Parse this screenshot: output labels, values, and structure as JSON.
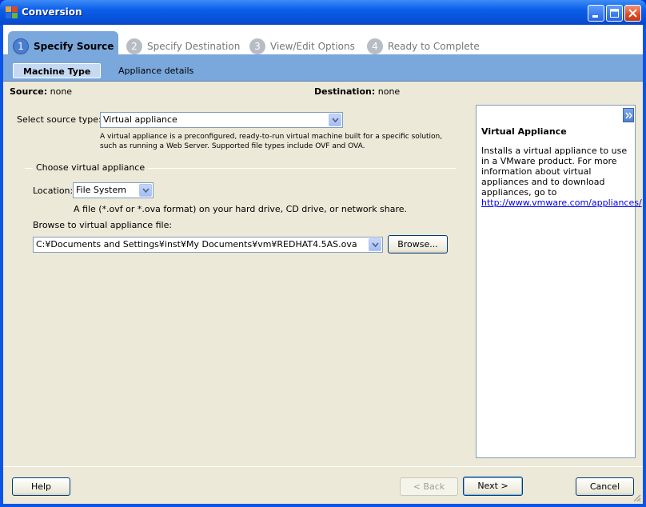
{
  "window": {
    "title": "Conversion",
    "accent": "#0a55e6"
  },
  "steps": [
    {
      "num": "1",
      "label": "Specify Source",
      "active": true
    },
    {
      "num": "2",
      "label": "Specify Destination"
    },
    {
      "num": "3",
      "label": "View/Edit Options"
    },
    {
      "num": "4",
      "label": "Ready to Complete"
    }
  ],
  "subtabs": [
    {
      "label": "Machine Type",
      "active": true
    },
    {
      "label": "Appliance details"
    }
  ],
  "source": {
    "label": "Source:",
    "value": "none"
  },
  "destination": {
    "label": "Destination:",
    "value": "none"
  },
  "source_type": {
    "label": "Select source type:",
    "value": "Virtual appliance",
    "description_line1": "A virtual appliance is a preconfigured, ready-to-run virtual machine built for a specific solution,",
    "description_line2": "such as running a Web Server. Supported file types include OVF and OVA."
  },
  "group": {
    "title": "Choose virtual appliance",
    "location_label": "Location:",
    "location_value": "File System",
    "location_hint": "A file (*.ovf or *.ova format) on your hard drive, CD drive, or network share.",
    "browse_label": "Browse to virtual appliance file:",
    "file_path": "C:¥Documents and Settings¥inst¥My Documents¥vm¥REDHAT4.5AS.ova",
    "browse_button": "Browse..."
  },
  "help_panel": {
    "title": "Virtual Appliance",
    "body": "Installs a virtual appliance to use in a VMware product. For more information about virtual appliances and to download appliances, go to",
    "link": "http://www.vmware.com/appliances/"
  },
  "footer": {
    "help": "Help",
    "back": "< Back",
    "next": "Next >",
    "cancel": "Cancel"
  }
}
